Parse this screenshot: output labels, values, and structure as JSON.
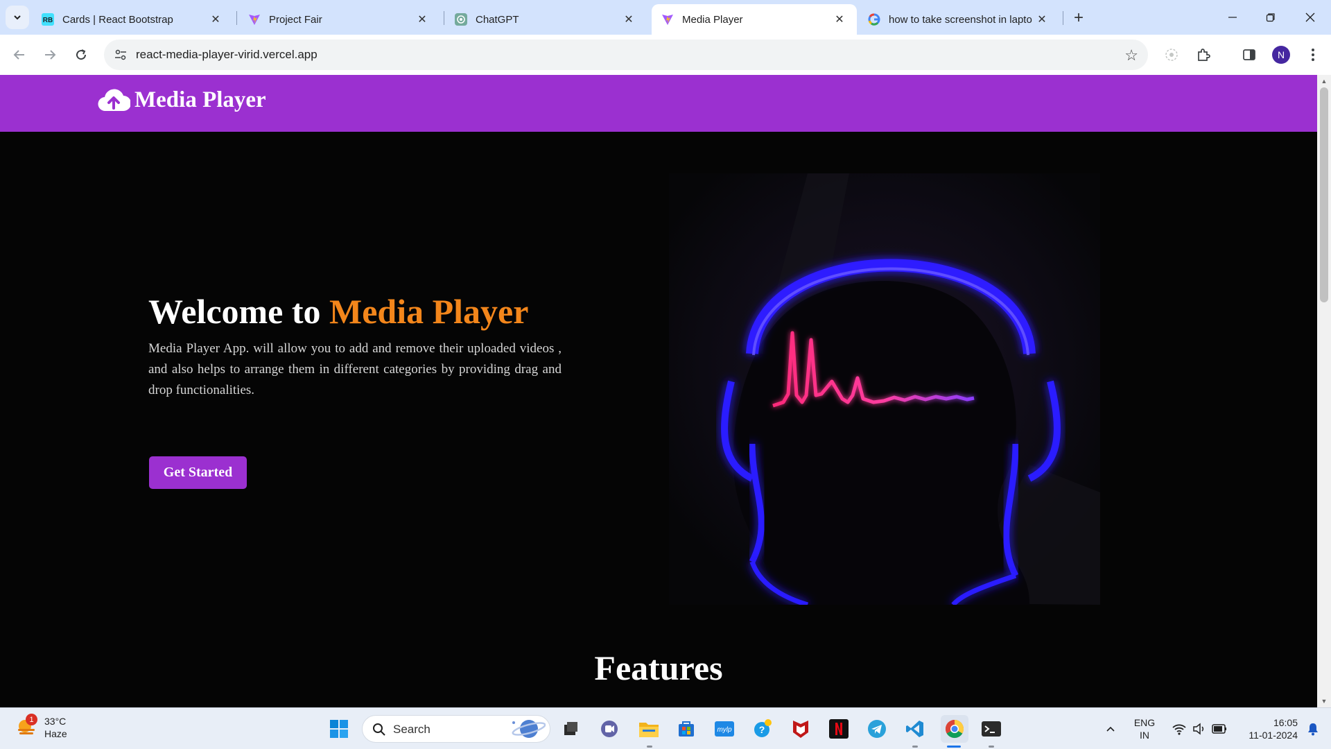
{
  "browser": {
    "tabs": [
      {
        "title": "Cards | React Bootstrap",
        "favicon": "react-bootstrap-icon",
        "active": false
      },
      {
        "title": "Project Fair",
        "favicon": "vite-icon",
        "active": false
      },
      {
        "title": "ChatGPT",
        "favicon": "chatgpt-icon",
        "active": false
      },
      {
        "title": "Media Player",
        "favicon": "vite-icon",
        "active": true
      },
      {
        "title": "how to take screenshot in lapto",
        "favicon": "google-icon",
        "active": false
      }
    ],
    "url": "react-media-player-virid.vercel.app",
    "profile_initial": "N"
  },
  "page": {
    "brand": "Media Player",
    "hero": {
      "title_prefix": "Welcome to ",
      "title_accent": "Media Player",
      "description": "Media Player App. will allow you to add and remove their uploaded videos , and also helps to arrange them in different categories by providing drag and drop functionalities.",
      "cta_label": "Get Started"
    },
    "features_heading": "Features",
    "colors": {
      "nav_bg": "#9b30d0",
      "accent": "#f3861b",
      "page_bg": "#050505"
    }
  },
  "taskbar": {
    "weather": {
      "temp": "33°C",
      "condition": "Haze",
      "badge": "1"
    },
    "search_label": "Search",
    "language": {
      "line1": "ENG",
      "line2": "IN"
    },
    "clock": {
      "time": "16:05",
      "date": "11-01-2024"
    }
  }
}
